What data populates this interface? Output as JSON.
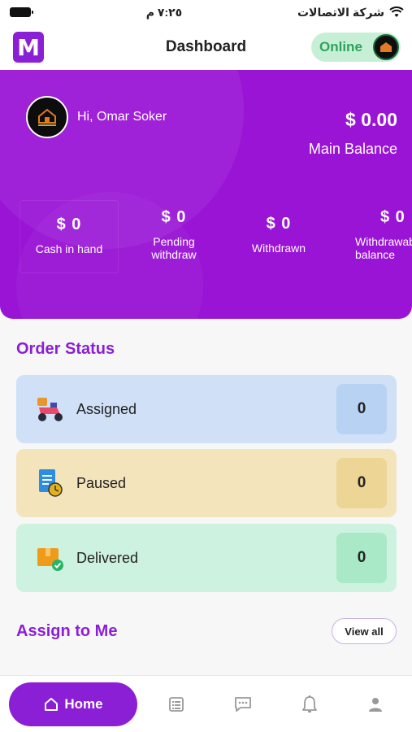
{
  "status_bar": {
    "carrier": "شركة الاتصالات",
    "time": "٧:٢٥ م"
  },
  "header": {
    "title": "Dashboard",
    "online_label": "Online"
  },
  "hero": {
    "greeting": "Hi, Omar Soker",
    "balance_amount": "$ 0.00",
    "balance_label": "Main Balance",
    "stats": [
      {
        "value": "$ 0",
        "label": "Cash in hand"
      },
      {
        "value": "$ 0",
        "label": "Pending withdraw"
      },
      {
        "value": "$ 0",
        "label": "Withdrawn"
      },
      {
        "value": "$ 0",
        "label": "Withdrawable balance"
      }
    ]
  },
  "order_status": {
    "title": "Order Status",
    "items": [
      {
        "label": "Assigned",
        "count": "0",
        "bg": "#cfe0f7",
        "box": "#b8d2f3"
      },
      {
        "label": "Paused",
        "count": "0",
        "bg": "#f3e4bb",
        "box": "#ecd595"
      },
      {
        "label": "Delivered",
        "count": "0",
        "bg": "#cdf2df",
        "box": "#a9e9c7"
      }
    ]
  },
  "assign": {
    "title": "Assign to Me",
    "view_all": "View all"
  },
  "nav": {
    "home_label": "Home"
  },
  "colors": {
    "primary": "#8b1fd6",
    "hero": "#9a14d6",
    "online_bg": "#c7efd6",
    "online_text": "#2ea35d"
  }
}
